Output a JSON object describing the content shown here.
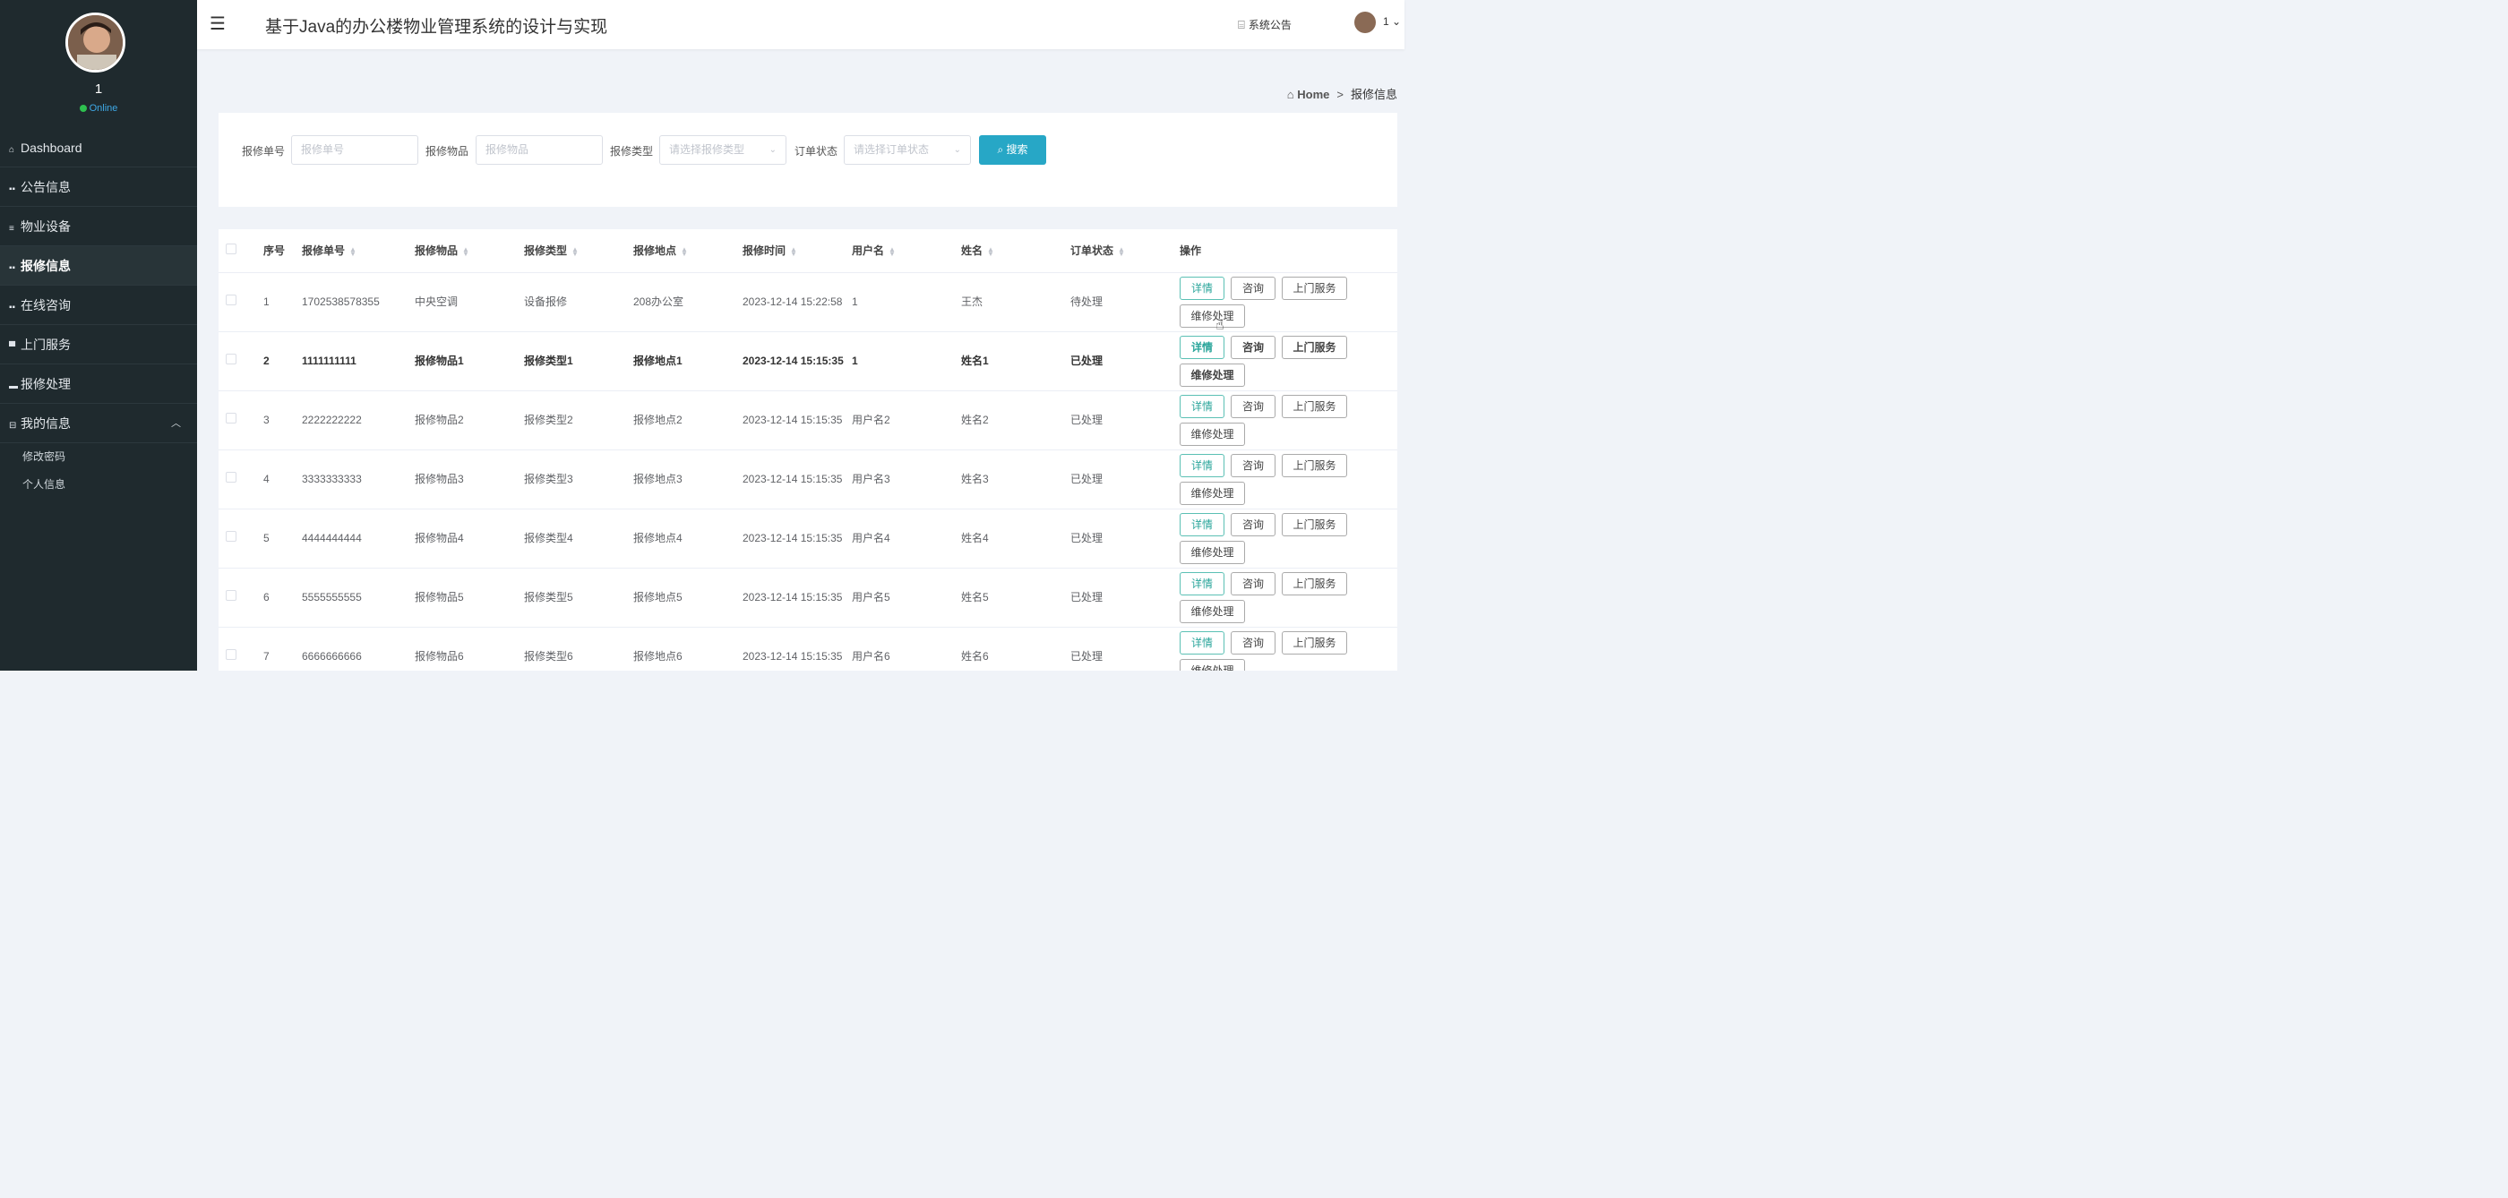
{
  "sidebar": {
    "user_name": "1",
    "status": "Online",
    "menu": [
      {
        "label": "Dashboard",
        "icon": "home-icon"
      },
      {
        "label": "公告信息",
        "icon": "grid-icon"
      },
      {
        "label": "物业设备",
        "icon": "list-icon"
      },
      {
        "label": "报修信息",
        "icon": "grid-icon"
      },
      {
        "label": "在线咨询",
        "icon": "grid-icon"
      },
      {
        "label": "上门服务",
        "icon": "monitor-icon"
      },
      {
        "label": "报修处理",
        "icon": "briefcase-icon"
      },
      {
        "label": "我的信息",
        "icon": "window-icon"
      }
    ],
    "submenu": [
      "修改密码",
      "个人信息"
    ]
  },
  "header": {
    "title": "基于Java的办公楼物业管理系统的设计与实现",
    "notice": "系统公告",
    "user": "1"
  },
  "breadcrumb": {
    "home": "Home",
    "current": "报修信息"
  },
  "search": {
    "fields": [
      {
        "label": "报修单号",
        "placeholder": "报修单号"
      },
      {
        "label": "报修物品",
        "placeholder": "报修物品"
      },
      {
        "label": "报修类型",
        "placeholder": "请选择报修类型"
      },
      {
        "label": "订单状态",
        "placeholder": "请选择订单状态"
      }
    ],
    "button": "搜索"
  },
  "table": {
    "headers": [
      "序号",
      "报修单号",
      "报修物品",
      "报修类型",
      "报修地点",
      "报修时间",
      "用户名",
      "姓名",
      "订单状态",
      "操作"
    ],
    "actions": [
      "详情",
      "咨询",
      "上门服务",
      "维修处理"
    ],
    "rows": [
      {
        "no": "1",
        "code": "1702538578355",
        "item": "中央空调",
        "type": "设备报修",
        "place": "208办公室",
        "time": "2023-12-14 15:22:58",
        "user": "1",
        "name": "王杰",
        "status": "待处理"
      },
      {
        "no": "2",
        "code": "1111111111",
        "item": "报修物品1",
        "type": "报修类型1",
        "place": "报修地点1",
        "time": "2023-12-14 15:15:35",
        "user": "1",
        "name": "姓名1",
        "status": "已处理"
      },
      {
        "no": "3",
        "code": "2222222222",
        "item": "报修物品2",
        "type": "报修类型2",
        "place": "报修地点2",
        "time": "2023-12-14 15:15:35",
        "user": "用户名2",
        "name": "姓名2",
        "status": "已处理"
      },
      {
        "no": "4",
        "code": "3333333333",
        "item": "报修物品3",
        "type": "报修类型3",
        "place": "报修地点3",
        "time": "2023-12-14 15:15:35",
        "user": "用户名3",
        "name": "姓名3",
        "status": "已处理"
      },
      {
        "no": "5",
        "code": "4444444444",
        "item": "报修物品4",
        "type": "报修类型4",
        "place": "报修地点4",
        "time": "2023-12-14 15:15:35",
        "user": "用户名4",
        "name": "姓名4",
        "status": "已处理"
      },
      {
        "no": "6",
        "code": "5555555555",
        "item": "报修物品5",
        "type": "报修类型5",
        "place": "报修地点5",
        "time": "2023-12-14 15:15:35",
        "user": "用户名5",
        "name": "姓名5",
        "status": "已处理"
      },
      {
        "no": "7",
        "code": "6666666666",
        "item": "报修物品6",
        "type": "报修类型6",
        "place": "报修地点6",
        "time": "2023-12-14 15:15:35",
        "user": "用户名6",
        "name": "姓名6",
        "status": "已处理"
      }
    ]
  },
  "colors": {
    "sidebar_bg": "#1f2a2e",
    "accent": "#27a7c6",
    "detail_btn": "#2aa59b"
  }
}
